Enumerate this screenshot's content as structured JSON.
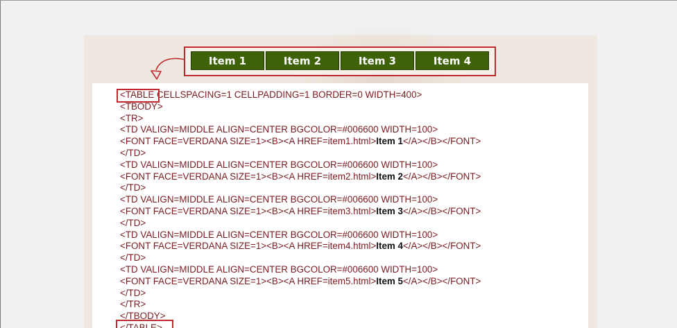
{
  "nav": {
    "items": [
      {
        "label": "Item 1"
      },
      {
        "label": "Item 2"
      },
      {
        "label": "Item 3"
      },
      {
        "label": "Item 4"
      }
    ],
    "button_color": "#3d6208",
    "highlight_color": "#c0282d"
  },
  "code": {
    "text_color": "#7b1a1f",
    "lines": [
      {
        "pre": "<TABLE",
        "post": " CELLSPACING=1 CELLPADDING=1 BORDER=0 WIDTH=400>"
      },
      {
        "pre": "<TBODY>"
      },
      {
        "pre": "<TR>"
      },
      {
        "pre": "<TD VALIGN=MIDDLE ALIGN=CENTER BGCOLOR=#006600 WIDTH=100>"
      },
      {
        "pre": "<FONT FACE=VERDANA SIZE=1><B><A HREF=item1.html>",
        "item": "Item 1",
        "post": "</A></B></FONT>"
      },
      {
        "pre": "</TD>"
      },
      {
        "pre": "<TD VALIGN=MIDDLE ALIGN=CENTER BGCOLOR=#006600 WIDTH=100>"
      },
      {
        "pre": "<FONT FACE=VERDANA SIZE=1><B><A HREF=item2.html>",
        "item": "Item 2",
        "post": "</A></B></FONT>"
      },
      {
        "pre": "</TD>"
      },
      {
        "pre": "<TD VALIGN=MIDDLE ALIGN=CENTER BGCOLOR=#006600 WIDTH=100>"
      },
      {
        "pre": "<FONT FACE=VERDANA SIZE=1><B><A HREF=item3.html>",
        "item": "Item 3",
        "post": "</A></B></FONT>"
      },
      {
        "pre": "</TD>"
      },
      {
        "pre": "<TD VALIGN=MIDDLE ALIGN=CENTER BGCOLOR=#006600 WIDTH=100>"
      },
      {
        "pre": "<FONT FACE=VERDANA SIZE=1><B><A HREF=item4.html>",
        "item": "Item 4",
        "post": "</A></B></FONT>"
      },
      {
        "pre": "</TD>"
      },
      {
        "pre": "<TD VALIGN=MIDDLE ALIGN=CENTER BGCOLOR=#006600 WIDTH=100>"
      },
      {
        "pre": "<FONT FACE=VERDANA SIZE=1><B><A HREF=item5.html>",
        "item": "Item 5",
        "post": "</A></B></FONT>"
      },
      {
        "pre": "</TD>"
      },
      {
        "pre": "</TR>"
      },
      {
        "pre": "</TBODY>"
      },
      {
        "pre": "</TABLE>"
      }
    ]
  }
}
